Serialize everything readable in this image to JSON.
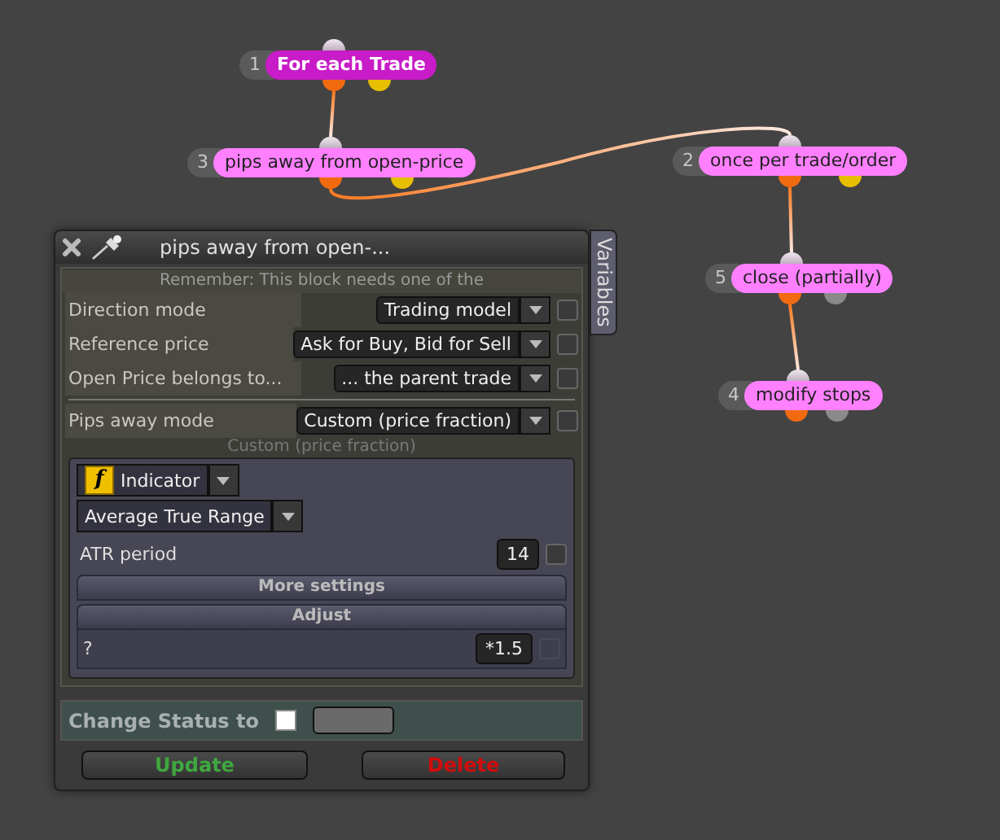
{
  "nodes": [
    {
      "number": "1",
      "label": "For each Trade",
      "selected": true,
      "ports": [
        {
          "color": "#f26a10"
        },
        {
          "color": "#e6bf00"
        }
      ]
    },
    {
      "number": "3",
      "label": "pips away from open-price",
      "selected": false,
      "ports": [
        {
          "color": "#f26a10"
        },
        {
          "color": "#e6bf00"
        }
      ]
    },
    {
      "number": "2",
      "label": "once per trade/order",
      "selected": false,
      "ports": [
        {
          "color": "#f26a10"
        },
        {
          "color": "#e6bf00"
        }
      ]
    },
    {
      "number": "5",
      "label": "close (partially)",
      "selected": false,
      "ports": [
        {
          "color": "#f26a10"
        },
        {
          "color": "#8a8a8a"
        }
      ]
    },
    {
      "number": "4",
      "label": "modify stops",
      "selected": false,
      "ports": [
        {
          "color": "#f26a10"
        },
        {
          "color": "#8a8a8a"
        }
      ]
    }
  ],
  "dialog": {
    "title": "pips away from open-...",
    "side_tab": "Variables",
    "notice": "Remember: This block needs one of the",
    "options": [
      {
        "label": "Direction mode",
        "value": "Trading model",
        "checked": false
      },
      {
        "label": "Reference price",
        "value": "Ask for Buy, Bid for Sell",
        "checked": false
      },
      {
        "label": "Open Price belongs to...",
        "value": "... the parent trade",
        "checked": false
      }
    ],
    "mode_option": {
      "label": "Pips away mode",
      "value": "Custom (price fraction)",
      "checked": false
    },
    "custom_caption": "Custom (price fraction)",
    "indicator_icon": "f",
    "indicator_type": "Indicator",
    "indicator": "Average True Range",
    "params": [
      {
        "label": "ATR period",
        "value": "14",
        "checked": false
      }
    ],
    "more_settings": "More settings",
    "adjust": {
      "title": "Adjust",
      "label": "?",
      "value": "*1.5",
      "disabled": true
    },
    "status": {
      "label": "Change Status to",
      "checked": false
    },
    "buttons": [
      {
        "label": "Update",
        "kind": "update"
      },
      {
        "label": "Delete",
        "kind": "delete"
      }
    ]
  }
}
